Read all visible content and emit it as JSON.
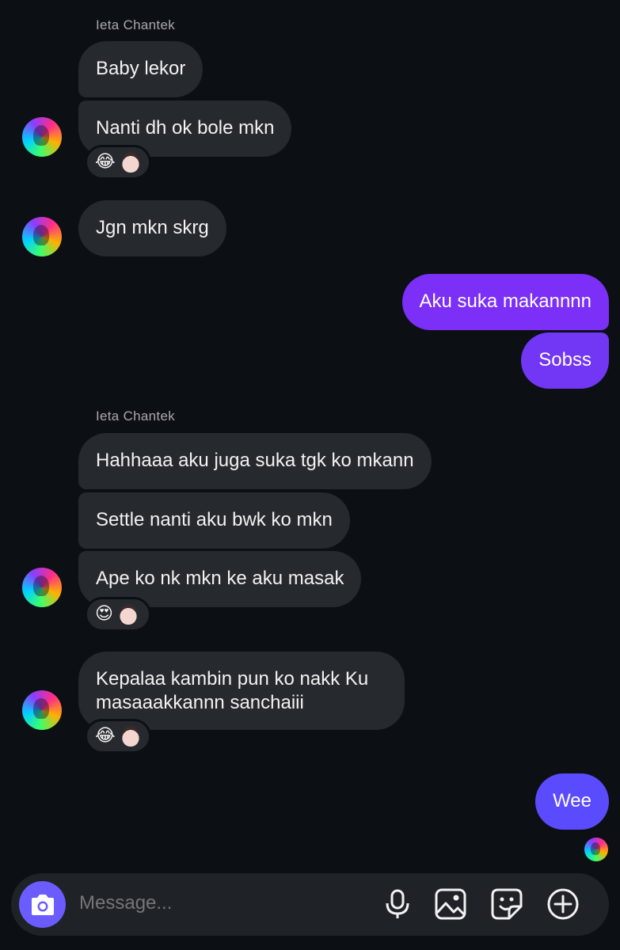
{
  "colors": {
    "background": "#0c1014",
    "incoming_bubble": "#262a2f",
    "outgoing_purple": "#7b2ff7",
    "outgoing_blue": "#5b4bff",
    "camera_button": "#6b5cff"
  },
  "thread": {
    "group1": {
      "sender": "Ieta Chantek",
      "messages": [
        "Baby lekor",
        "Nanti dh ok bole mkn"
      ],
      "reaction": "😂"
    },
    "group2": {
      "messages": [
        "Jgn mkn skrg"
      ]
    },
    "outgoing1": {
      "messages": [
        "Aku suka makannnn",
        "Sobss"
      ]
    },
    "group3": {
      "sender": "Ieta Chantek",
      "messages": [
        "Hahhaaa aku juga suka tgk ko mkann",
        "Settle nanti aku bwk ko mkn",
        "Ape ko nk mkn ke aku masak"
      ],
      "reaction": "😍"
    },
    "group4": {
      "messages": [
        "Kepalaa kambin pun ko nakk Ku",
        "masaaakkannn sanchaiii"
      ],
      "reaction": "😂"
    },
    "outgoing2": {
      "messages": [
        "Wee"
      ]
    }
  },
  "composer": {
    "placeholder": "Message...",
    "icons": [
      "camera-icon",
      "microphone-icon",
      "gallery-icon",
      "sticker-icon",
      "plus-icon"
    ]
  }
}
